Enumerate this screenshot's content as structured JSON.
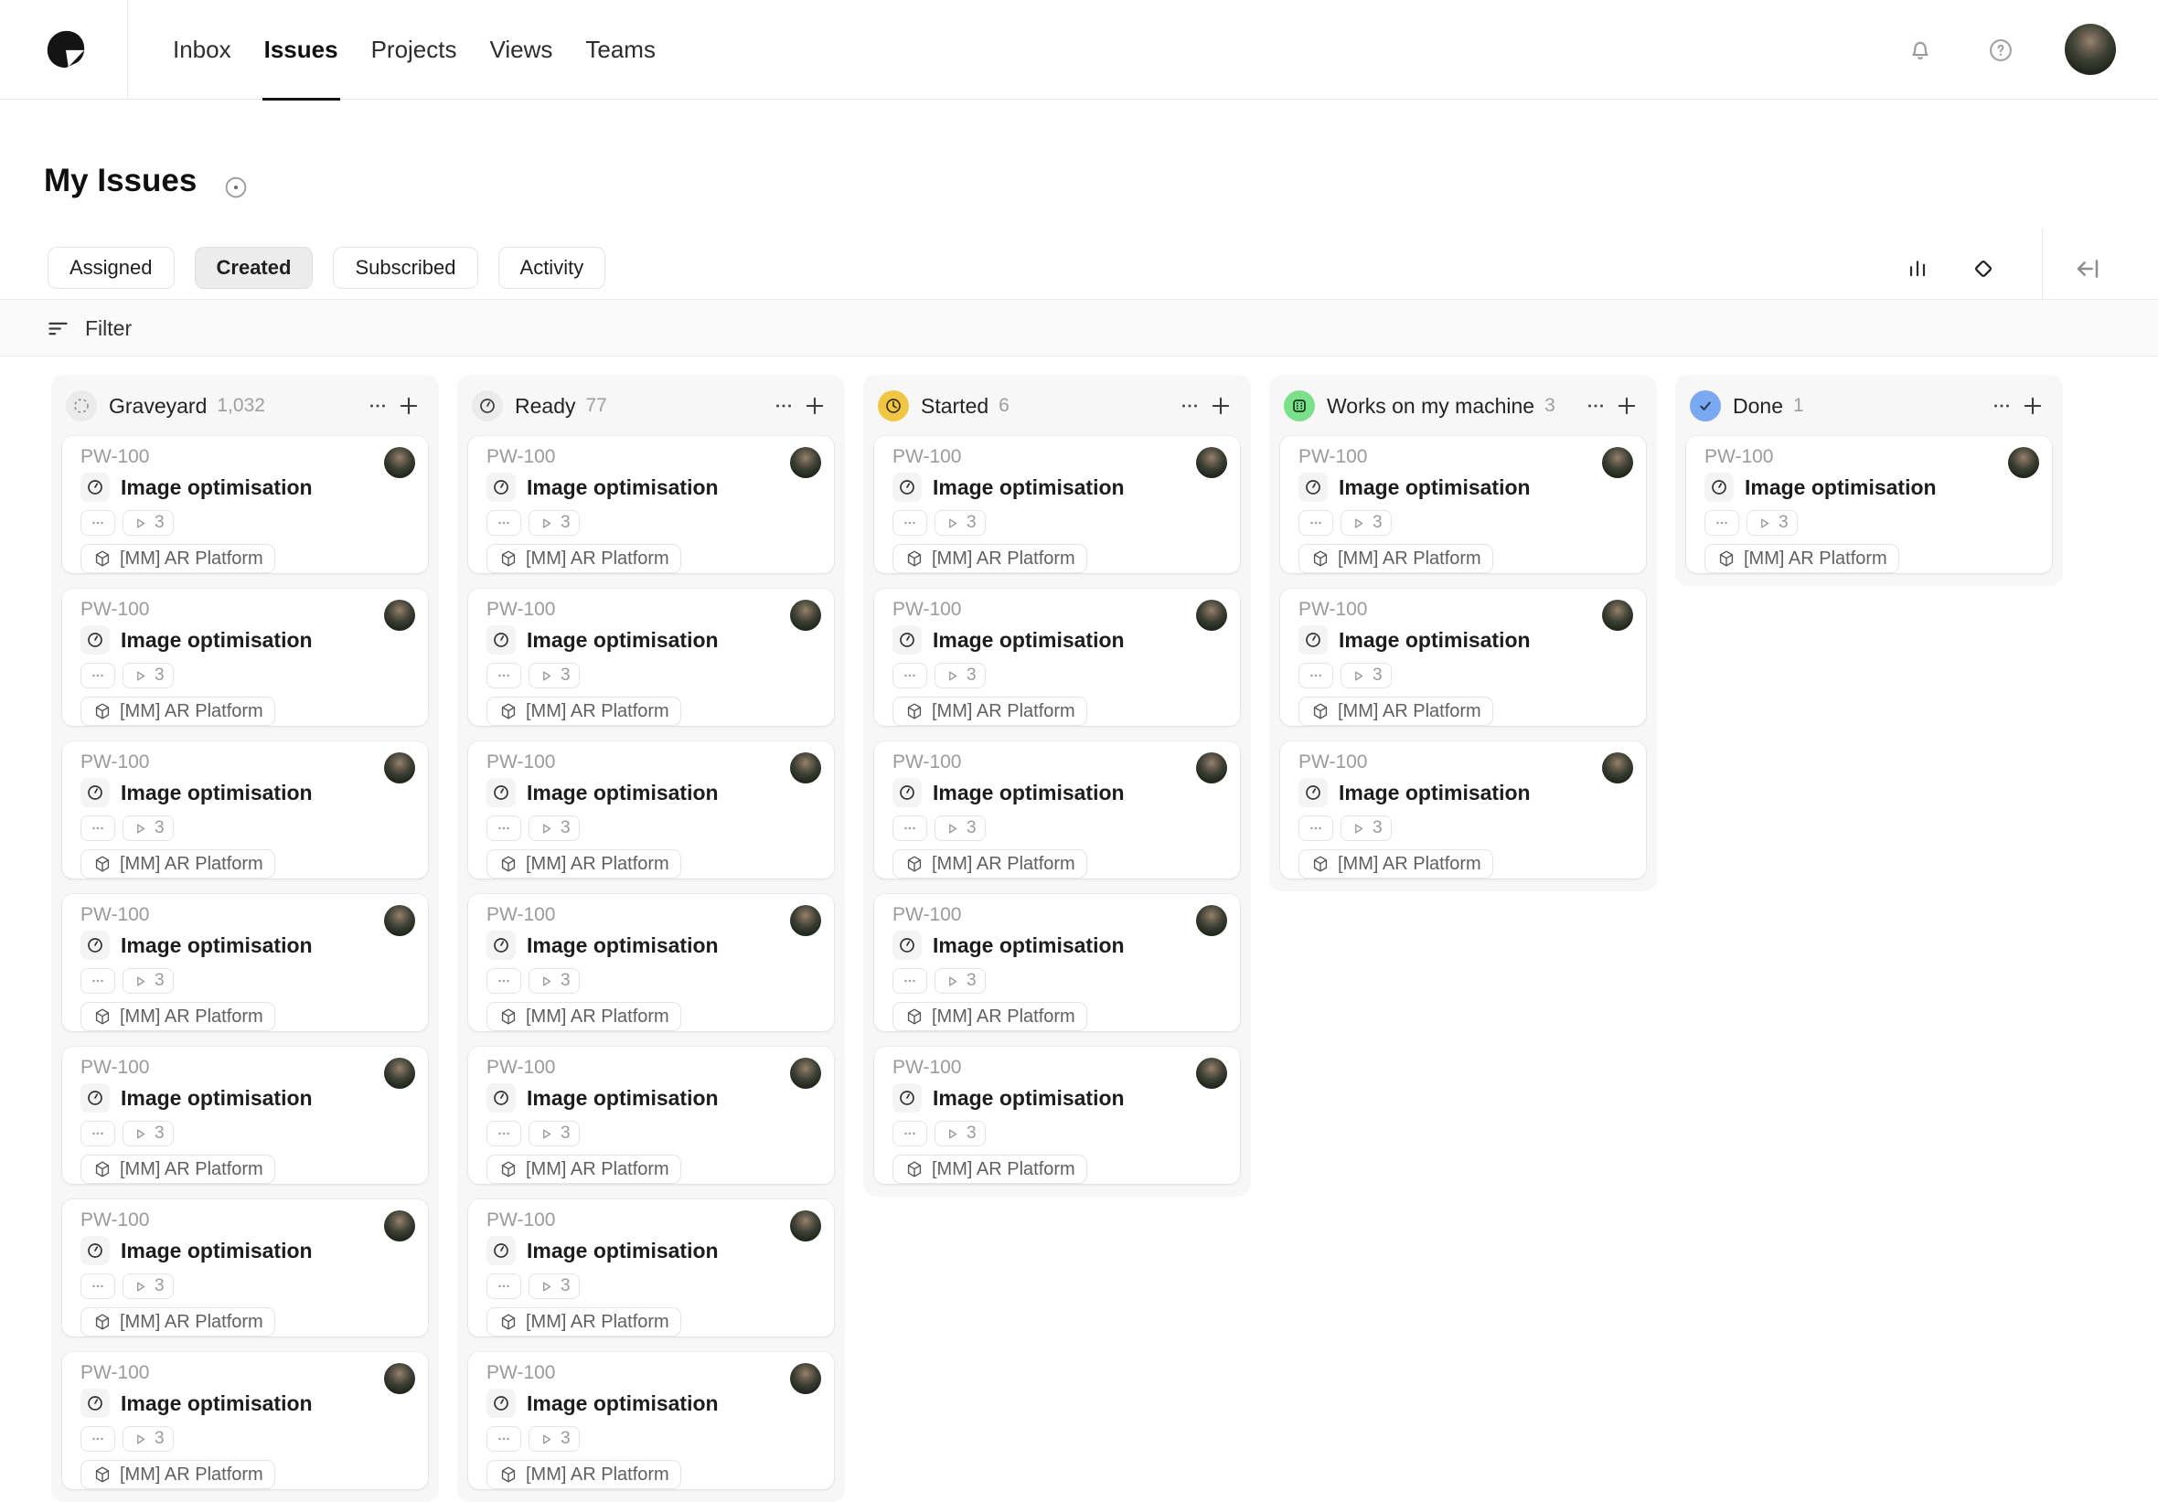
{
  "header": {
    "logo_icon": "app-logo",
    "nav": [
      {
        "label": "Inbox",
        "active": false
      },
      {
        "label": "Issues",
        "active": true
      },
      {
        "label": "Projects",
        "active": false
      },
      {
        "label": "Views",
        "active": false
      },
      {
        "label": "Teams",
        "active": false
      }
    ],
    "right_icons": [
      "notifications-bell-icon",
      "help-icon",
      "user-avatar"
    ]
  },
  "page": {
    "title": "My Issues",
    "title_icon": "target-icon"
  },
  "tabs": {
    "items": [
      {
        "label": "Assigned",
        "selected": false
      },
      {
        "label": "Created",
        "selected": true
      },
      {
        "label": "Subscribed",
        "selected": false
      },
      {
        "label": "Activity",
        "selected": false
      }
    ],
    "toolbar_icons": [
      "bar-chart-icon",
      "diamond-icon",
      "collapse-right-panel-icon"
    ]
  },
  "filter": {
    "label": "Filter",
    "icon": "filter-lines-icon"
  },
  "board": {
    "card": {
      "id": "PW-100",
      "title": "Image optimisation",
      "status_icon": "clock-icon",
      "more_icon": "ellipsis-icon",
      "subtask_icon": "play-icon",
      "subtask_count": "3",
      "project_icon": "cube-icon",
      "project": "[MM] AR Platform"
    },
    "columns": [
      {
        "name": "Graveyard",
        "count": "1,032",
        "icon": "dashed-circle",
        "icon_bg": "#ebebeb",
        "visible_cards": 7,
        "last_card_clipped": true
      },
      {
        "name": "Ready",
        "count": "77",
        "icon": "clock",
        "icon_bg": "#ebebeb",
        "visible_cards": 7,
        "last_card_clipped": true
      },
      {
        "name": "Started",
        "count": "6",
        "icon": "clock-filled",
        "icon_bg": "#f2c645",
        "visible_cards": 5,
        "last_card_clipped": false
      },
      {
        "name": "Works on my machine",
        "count": "3",
        "icon": "machine",
        "icon_bg": "#7be08a",
        "visible_cards": 3,
        "last_card_clipped": false
      },
      {
        "name": "Done",
        "count": "1",
        "icon": "check",
        "icon_bg": "#7aa9f2",
        "visible_cards": 1,
        "last_card_clipped": false
      }
    ]
  },
  "colors": {
    "started_accent": "#f2c645",
    "works_accent": "#7be08a",
    "done_accent": "#7aa9f2",
    "column_bg": "#f7f7f7",
    "filter_bar_bg": "#fafafa",
    "border": "#e9e9e9",
    "muted_text": "#9b9b9b"
  }
}
